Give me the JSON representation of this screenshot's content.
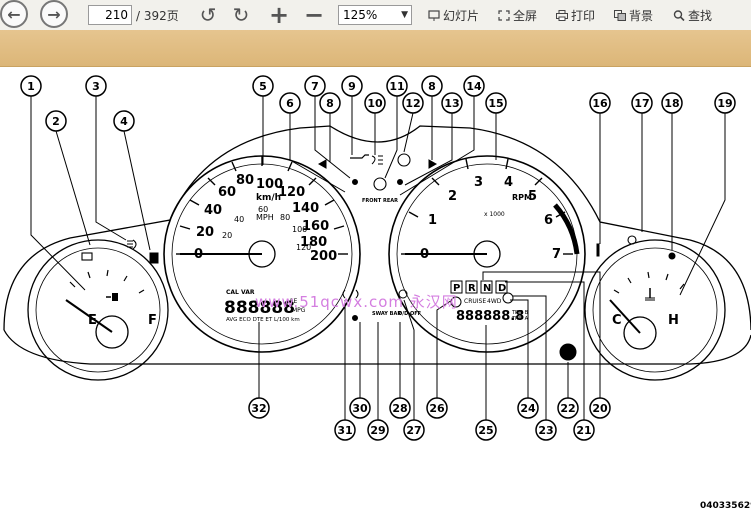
{
  "toolbar": {
    "current_page": "210",
    "page_total": "/ 392页",
    "zoom": "125%",
    "slideshow_label": "幻灯片",
    "fullscreen_label": "全屏",
    "print_label": "打印",
    "background_label": "背景",
    "find_label": "查找",
    "icons": [
      "back-arrow-icon",
      "forward-arrow-icon",
      "rotate-left-icon",
      "rotate-right-icon",
      "zoom-in-icon",
      "zoom-out-icon",
      "slideshow-icon",
      "fullscreen-icon",
      "print-icon",
      "background-icon",
      "search-icon"
    ]
  },
  "figure": {
    "callouts": [
      "1",
      "2",
      "3",
      "4",
      "5",
      "6",
      "7",
      "8",
      "9",
      "10",
      "11",
      "12",
      "8",
      "13",
      "14",
      "15",
      "16",
      "17",
      "18",
      "19",
      "20",
      "21",
      "22",
      "23",
      "24",
      "25",
      "26",
      "27",
      "28",
      "29",
      "30",
      "31",
      "32"
    ],
    "speedometer": {
      "mph_ticks": [
        "20",
        "40",
        "60",
        "80",
        "100",
        "120",
        "140",
        "160",
        "180",
        "200"
      ],
      "kmh_ticks": [
        "20",
        "40",
        "60",
        "80",
        "100",
        "120"
      ],
      "unit_kmh": "km/h",
      "unit_mph": "MPH",
      "zero": "0"
    },
    "tachometer": {
      "ticks": [
        "1",
        "2",
        "3",
        "4",
        "5",
        "6",
        "7"
      ],
      "zero": "0",
      "label": "RPM",
      "multiplier": "x 1000"
    },
    "fuel_gauge": {
      "empty": "E",
      "full": "F"
    },
    "temp_gauge": {
      "cold": "C",
      "hot": "H"
    },
    "evic": {
      "caption": "CAL VAR",
      "digits": "888888",
      "unit_fe": "FE",
      "unit_mpg": "MPG",
      "modes": "AVG ECO DTE ET L/100 km"
    },
    "odometer": {
      "digits": "888888.8",
      "trip_b": "TRIP B",
      "trip_a": "TRIP A",
      "cruise": "CRUISE",
      "4wd": "4WD"
    },
    "prnd": [
      "P",
      "R",
      "N",
      "D"
    ],
    "sway_bar": "SWAY BAR",
    "od_off": "O/D OFF",
    "airbag_front": "FRONT",
    "airbag_rear": "REAR",
    "watermark": "www.51qcwx.com 永汉网",
    "doc_code": "040335629"
  }
}
